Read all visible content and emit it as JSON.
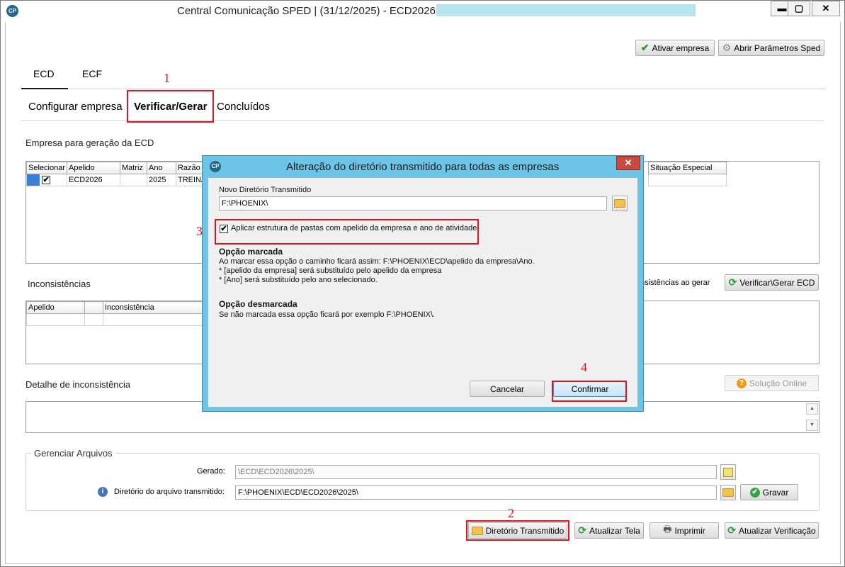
{
  "window": {
    "title": "Central Comunicação SPED | (31/12/2025) - ECD2026 -",
    "app_icon_text": "CP",
    "minimize": "▬",
    "maximize": "▢",
    "close": "✕"
  },
  "toolbar": {
    "activate_company": "Ativar empresa",
    "open_sped_params": "Abrir Parâmetros Sped"
  },
  "tabs": {
    "main": [
      "ECD",
      "ECF"
    ],
    "sub": [
      "Configurar empresa",
      "Verificar/Gerar",
      "Concluídos"
    ]
  },
  "companies": {
    "label": "Empresa para geração da ECD",
    "columns": [
      "Selecionar",
      "Apelido",
      "Matriz",
      "Ano",
      "Razão S"
    ],
    "right_column": "Situação Especial",
    "rows": [
      {
        "selected": "✔",
        "apelido": "ECD2026",
        "matriz": "",
        "ano": "2025",
        "razao": "TREINA"
      }
    ]
  },
  "inconsistencies": {
    "label": "Inconsistências",
    "ignore_label": "nsistências ao gerar",
    "verify_button": "Verificar\\Gerar ECD",
    "columns": [
      "Apelido",
      "",
      "Inconsistência"
    ]
  },
  "detail": {
    "label": "Detalhe de inconsistência",
    "online_solution": "Solução Online",
    "scroll_up": "▲",
    "scroll_down": "▼"
  },
  "files": {
    "group_title": "Gerenciar Arquivos",
    "generated_label": "Gerado:",
    "generated_value": "\\ECD\\ECD2026\\2025\\",
    "transmitted_label": "Diretório do arquivo transmitido:",
    "transmitted_value": "F:\\PHOENIX\\ECD\\ECD2026\\2025\\",
    "save_button": "Gravar"
  },
  "bottom_buttons": {
    "transmitted_dir": "Diretório Transmitido",
    "refresh_screen": "Atualizar Tela",
    "print": "Imprimir",
    "refresh_check": "Atualizar Verificação"
  },
  "dialog": {
    "title": "Alteração do diretório transmitido para todas as empresas",
    "new_dir_label": "Novo Diretório Transmitido",
    "new_dir_value": "F:\\PHOENIX\\",
    "apply_structure_label": "Aplicar estrutura de pastas com apelido da empresa e ano de atividade",
    "checked_heading": "Opção marcada",
    "checked_lines": [
      "Ao marcar essa opção o caminho ficará assim: F:\\PHOENIX\\ECD\\apelido da empresa\\Ano.",
      "* [apelido da empresa] será substituído pelo apelido da empresa",
      "* [Ano] será substituído pelo ano selecionado."
    ],
    "unchecked_heading": "Opção desmarcada",
    "unchecked_line": "Se não marcada essa opção ficará por exemplo F:\\PHOENIX\\.",
    "cancel": "Cancelar",
    "confirm": "Confirmar"
  },
  "annotations": [
    "1",
    "2",
    "3",
    "4"
  ]
}
